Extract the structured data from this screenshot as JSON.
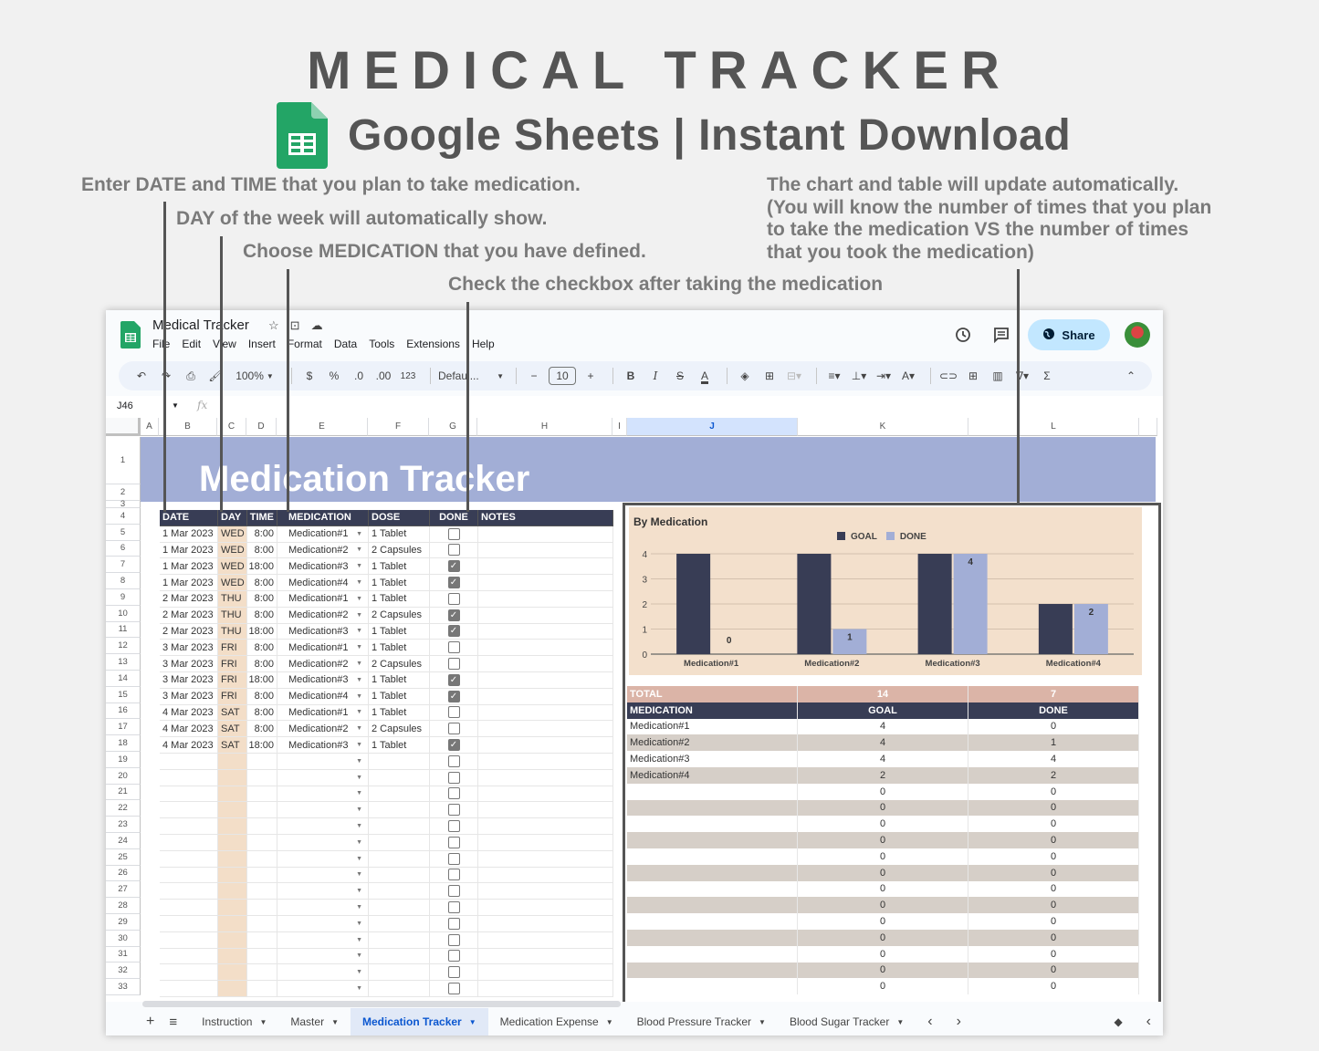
{
  "banner": {
    "title": "MEDICAL TRACKER",
    "subtitle": "Google Sheets | Instant Download"
  },
  "notes": {
    "date_time": "Enter DATE and TIME that you plan to take medication.",
    "day": "DAY of the week will automatically show.",
    "medication": "Choose MEDICATION that you have defined.",
    "checkbox": "Check the checkbox after taking the medication",
    "chart_lines": [
      "The chart and table will update automatically.",
      "(You will know the number of times that you plan",
      "to take the medication VS the number of times",
      "that you took the medication)"
    ]
  },
  "app": {
    "doc_title": "Medical Tracker",
    "menu": [
      "File",
      "Edit",
      "View",
      "Insert",
      "Format",
      "Data",
      "Tools",
      "Extensions",
      "Help"
    ],
    "share_label": "Share",
    "toolbar": {
      "zoom": "100%",
      "currency": "$",
      "percent": "%",
      "dec_decrease": ".0",
      "dec_increase": ".00",
      "number_format": "123",
      "font": "Defaul...",
      "font_size": "10",
      "bold": "B",
      "italic": "I"
    },
    "name_box": "J46",
    "fx": "fx"
  },
  "grid": {
    "columns": [
      "A",
      "B",
      "C",
      "D",
      "E",
      "F",
      "G",
      "H",
      "I",
      "J",
      "K",
      "L"
    ],
    "selected_column": "J",
    "row_numbers": [
      "1",
      "2",
      "3",
      "4",
      "5",
      "6",
      "7",
      "8",
      "9",
      "10",
      "11",
      "12",
      "13",
      "14",
      "15",
      "16",
      "17",
      "18",
      "19",
      "20",
      "21",
      "22",
      "23",
      "24",
      "25",
      "26",
      "27",
      "28",
      "29",
      "30",
      "31",
      "32",
      "33"
    ],
    "sheet_title": "Medication Tracker"
  },
  "tracker": {
    "headers": [
      "DATE",
      "DAY",
      "TIME",
      "MEDICATION",
      "DOSE",
      "DONE",
      "NOTES"
    ],
    "rows": [
      {
        "date": "1 Mar 2023",
        "day": "WED",
        "time": "8:00",
        "medication": "Medication#1",
        "dose": "1 Tablet",
        "done": false,
        "notes": ""
      },
      {
        "date": "1 Mar 2023",
        "day": "WED",
        "time": "8:00",
        "medication": "Medication#2",
        "dose": "2 Capsules",
        "done": false,
        "notes": ""
      },
      {
        "date": "1 Mar 2023",
        "day": "WED",
        "time": "18:00",
        "medication": "Medication#3",
        "dose": "1 Tablet",
        "done": true,
        "notes": ""
      },
      {
        "date": "1 Mar 2023",
        "day": "WED",
        "time": "8:00",
        "medication": "Medication#4",
        "dose": "1 Tablet",
        "done": true,
        "notes": ""
      },
      {
        "date": "2 Mar 2023",
        "day": "THU",
        "time": "8:00",
        "medication": "Medication#1",
        "dose": "1 Tablet",
        "done": false,
        "notes": ""
      },
      {
        "date": "2 Mar 2023",
        "day": "THU",
        "time": "8:00",
        "medication": "Medication#2",
        "dose": "2 Capsules",
        "done": true,
        "notes": ""
      },
      {
        "date": "2 Mar 2023",
        "day": "THU",
        "time": "18:00",
        "medication": "Medication#3",
        "dose": "1 Tablet",
        "done": true,
        "notes": ""
      },
      {
        "date": "3 Mar 2023",
        "day": "FRI",
        "time": "8:00",
        "medication": "Medication#1",
        "dose": "1 Tablet",
        "done": false,
        "notes": ""
      },
      {
        "date": "3 Mar 2023",
        "day": "FRI",
        "time": "8:00",
        "medication": "Medication#2",
        "dose": "2 Capsules",
        "done": false,
        "notes": ""
      },
      {
        "date": "3 Mar 2023",
        "day": "FRI",
        "time": "18:00",
        "medication": "Medication#3",
        "dose": "1 Tablet",
        "done": true,
        "notes": ""
      },
      {
        "date": "3 Mar 2023",
        "day": "FRI",
        "time": "8:00",
        "medication": "Medication#4",
        "dose": "1 Tablet",
        "done": true,
        "notes": ""
      },
      {
        "date": "4 Mar 2023",
        "day": "SAT",
        "time": "8:00",
        "medication": "Medication#1",
        "dose": "1 Tablet",
        "done": false,
        "notes": ""
      },
      {
        "date": "4 Mar 2023",
        "day": "SAT",
        "time": "8:00",
        "medication": "Medication#2",
        "dose": "2 Capsules",
        "done": false,
        "notes": ""
      },
      {
        "date": "4 Mar 2023",
        "day": "SAT",
        "time": "18:00",
        "medication": "Medication#3",
        "dose": "1 Tablet",
        "done": true,
        "notes": ""
      }
    ],
    "empty_rows": 15
  },
  "chart_data": {
    "type": "bar",
    "title": "By Medication",
    "categories": [
      "Medication#1",
      "Medication#2",
      "Medication#3",
      "Medication#4"
    ],
    "series": [
      {
        "name": "GOAL",
        "values": [
          4,
          4,
          4,
          2
        ],
        "color": "#383d55"
      },
      {
        "name": "DONE",
        "values": [
          0,
          1,
          4,
          2
        ],
        "color": "#a2aed6"
      }
    ],
    "xlabel": "",
    "ylabel": "",
    "ylim": [
      0,
      4
    ],
    "yticks": [
      0,
      1,
      2,
      3,
      4
    ],
    "grid": true,
    "legend": "top-center",
    "data_labels_series": "DONE"
  },
  "summary": {
    "total_label": "TOTAL",
    "total_goal": "14",
    "total_done": "7",
    "headers": [
      "MEDICATION",
      "GOAL",
      "DONE"
    ],
    "rows": [
      {
        "medication": "Medication#1",
        "goal": "4",
        "done": "0"
      },
      {
        "medication": "Medication#2",
        "goal": "4",
        "done": "1"
      },
      {
        "medication": "Medication#3",
        "goal": "4",
        "done": "4"
      },
      {
        "medication": "Medication#4",
        "goal": "2",
        "done": "2"
      },
      {
        "medication": "",
        "goal": "0",
        "done": "0"
      },
      {
        "medication": "",
        "goal": "0",
        "done": "0"
      },
      {
        "medication": "",
        "goal": "0",
        "done": "0"
      },
      {
        "medication": "",
        "goal": "0",
        "done": "0"
      },
      {
        "medication": "",
        "goal": "0",
        "done": "0"
      },
      {
        "medication": "",
        "goal": "0",
        "done": "0"
      },
      {
        "medication": "",
        "goal": "0",
        "done": "0"
      },
      {
        "medication": "",
        "goal": "0",
        "done": "0"
      },
      {
        "medication": "",
        "goal": "0",
        "done": "0"
      },
      {
        "medication": "",
        "goal": "0",
        "done": "0"
      },
      {
        "medication": "",
        "goal": "0",
        "done": "0"
      },
      {
        "medication": "",
        "goal": "0",
        "done": "0"
      },
      {
        "medication": "",
        "goal": "0",
        "done": "0"
      }
    ]
  },
  "sheet_tabs": [
    {
      "label": "Instruction",
      "active": false
    },
    {
      "label": "Master",
      "active": false
    },
    {
      "label": "Medication Tracker",
      "active": true
    },
    {
      "label": "Medication Expense",
      "active": false
    },
    {
      "label": "Blood Pressure Tracker",
      "active": false
    },
    {
      "label": "Blood Sugar Tracker",
      "active": false
    }
  ],
  "colors": {
    "header_dark": "#383d55",
    "title_band": "#a2aed6",
    "day_column": "#f3dec8",
    "chart_bg": "#f3e0cc",
    "total_row": "#dbb4a7",
    "alt_row": "#d6cfc8",
    "share_button": "#c2e7ff"
  }
}
